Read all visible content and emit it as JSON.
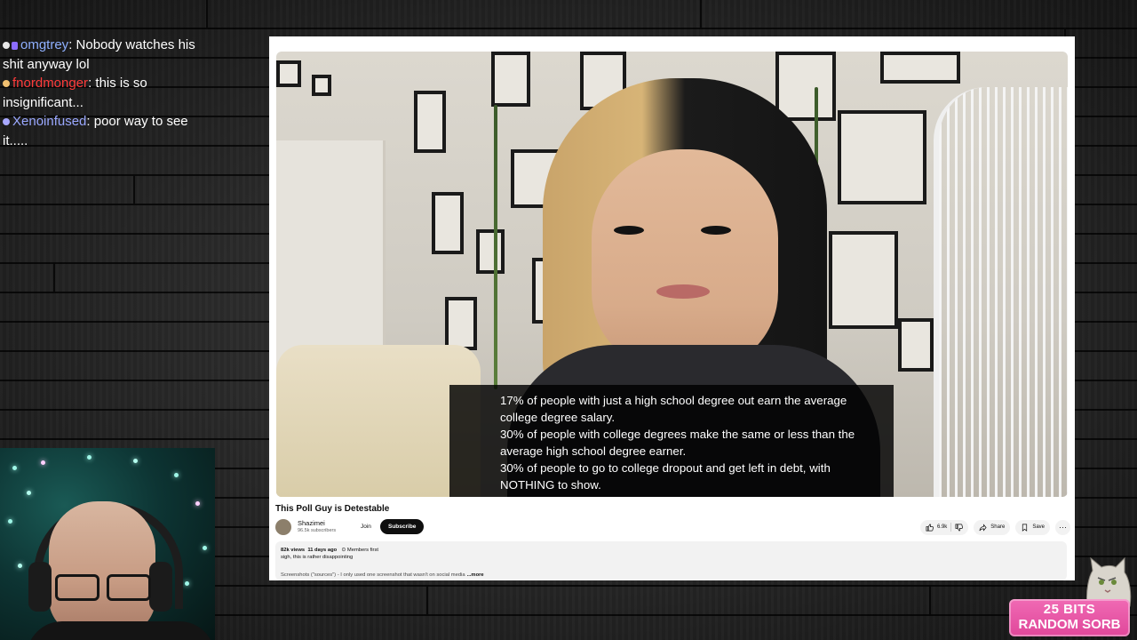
{
  "chat": {
    "messages": [
      {
        "user": "omgtrey",
        "text": ": Nobody watches his shit anyway lol",
        "user_color": "#8fb0ff"
      },
      {
        "user": "fnordmonger",
        "text": ": this is so insignificant...",
        "user_color": "#ff3b3b"
      },
      {
        "user": "Xenoinfused",
        "text": ": poor way to see it.....",
        "user_color": "#9aa8ff"
      }
    ]
  },
  "video": {
    "caption_lines": [
      "17% of people with just a high school degree out earn the average college degree salary.",
      "30% of people with college degrees make the same or less than the average high school degree earner.",
      "30% of people to go to college dropout and get left in debt, with NOTHING to show."
    ],
    "title": "This Poll Guy is Detestable"
  },
  "channel": {
    "name": "Shazimei",
    "subscribers": "96.5k subscribers",
    "join_label": "Join",
    "subscribe_label": "Subscribe"
  },
  "actions": {
    "likes": "6.9k",
    "share_label": "Share",
    "save_label": "Save",
    "more_label": "···"
  },
  "description": {
    "views": "82k views",
    "date": "11 days ago",
    "members": "Members first",
    "line1": "sigh, this is rather disappointing",
    "sources": "Screenshots (\"sources\") - I only used one screenshot that wasn't on social media",
    "more_label": "...more"
  },
  "alert": {
    "line1": "25 BITS",
    "line2": "RANDOM SORB"
  },
  "colors": {
    "subscribe_bg": "#0f0f0f",
    "alert_bg": "#e0479a",
    "caption_bg": "#000000"
  }
}
